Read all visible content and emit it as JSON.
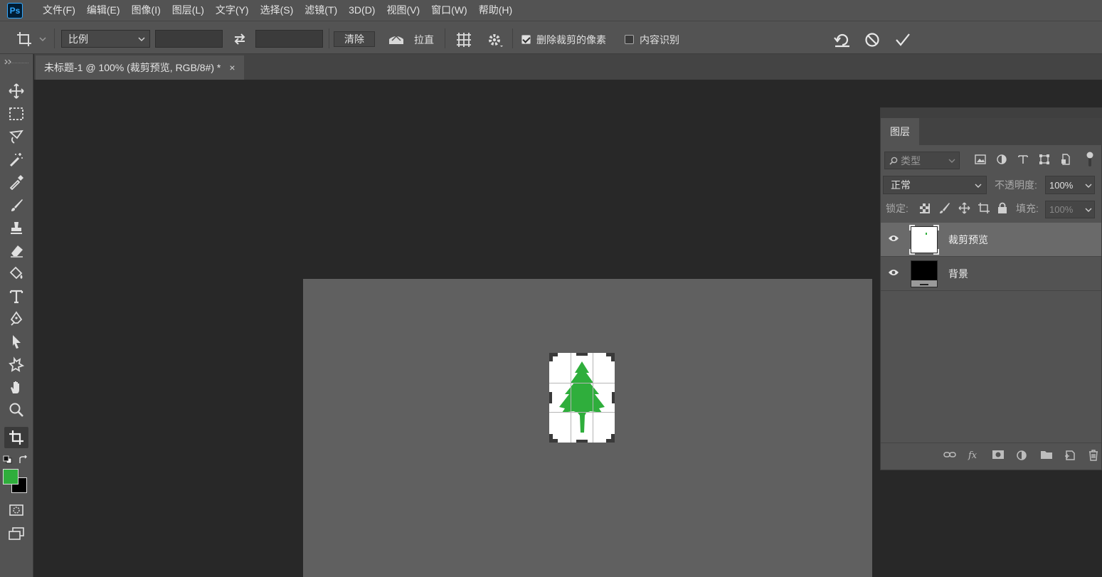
{
  "app": {
    "logo": "Ps"
  },
  "menu": [
    "文件(F)",
    "编辑(E)",
    "图像(I)",
    "图层(L)",
    "文字(Y)",
    "选择(S)",
    "滤镜(T)",
    "3D(D)",
    "视图(V)",
    "窗口(W)",
    "帮助(H)"
  ],
  "options": {
    "ratio_select": "比例",
    "width_value": "",
    "height_value": "",
    "clear_label": "清除",
    "straighten_label": "拉直",
    "delete_cropped_label": "删除裁剪的像素",
    "delete_cropped_checked": true,
    "content_aware_label": "内容识别",
    "content_aware_checked": false
  },
  "document_tab": {
    "title": "未标题-1 @ 100% (裁剪预览, RGB/8#) *",
    "close": "×"
  },
  "colors": {
    "foreground": "#2fae3c",
    "background": "#000000",
    "tree": "#2fae3c"
  },
  "layers_panel": {
    "tab_label": "图层",
    "filter_placeholder": "类型",
    "blend_mode": "正常",
    "opacity_label": "不透明度:",
    "opacity_value": "100%",
    "lock_label": "锁定:",
    "fill_label": "填充:",
    "fill_value": "100%",
    "layers": [
      {
        "name": "裁剪预览",
        "selected": true
      },
      {
        "name": "背景",
        "selected": false
      }
    ]
  }
}
